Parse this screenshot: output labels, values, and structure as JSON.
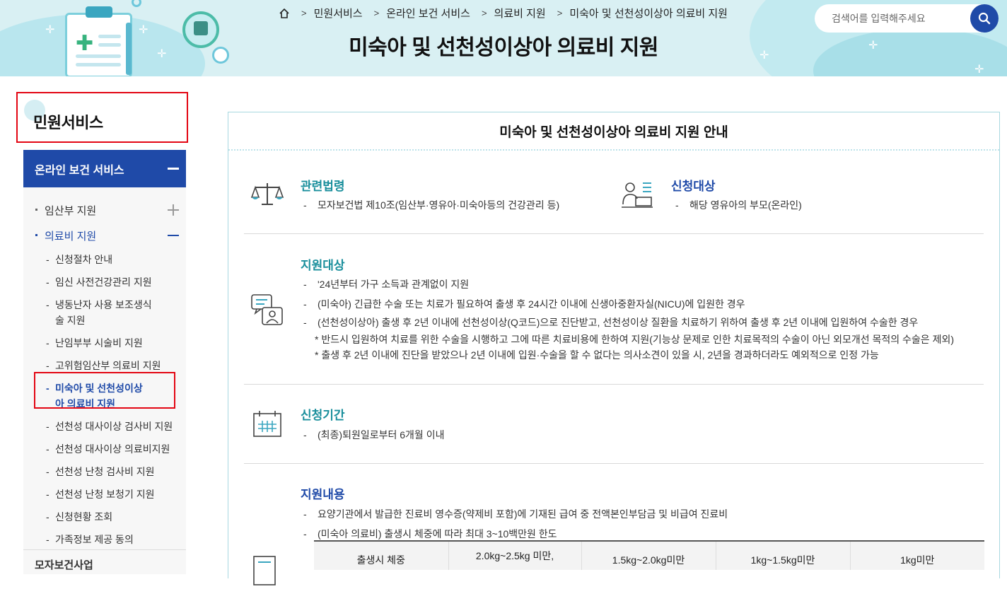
{
  "header": {
    "breadcrumb": [
      "민원서비스",
      "온라인 보건 서비스",
      "의료비 지원",
      "미숙아 및 선천성이상아 의료비 지원"
    ],
    "page_title": "미숙아 및 선천성이상아 의료비 지원",
    "search_placeholder": "검색어를 입력해주세요"
  },
  "sidebar": {
    "title": "민원서비스",
    "section_label": "온라인 보건 서비스",
    "depth2": [
      {
        "label": "임산부 지원",
        "state": "collapsed"
      },
      {
        "label": "의료비 지원",
        "state": "expanded"
      }
    ],
    "depth3": [
      "신청절차 안내",
      "임신 사전건강관리 지원",
      "냉동난자 사용 보조생식술 지원",
      "난임부부 시술비 지원",
      "고위험임산부 의료비 지원",
      "미숙아 및 선천성이상아 의료비 지원",
      "선천성 대사이상 검사비 지원",
      "선천성 대사이상 의료비지원",
      "선천성 난청 검사비 지원",
      "선천성 난청 보청기 지원",
      "신청현황 조회",
      "가족정보 제공 동의"
    ],
    "next_section_label": "모자보건사업"
  },
  "content": {
    "title": "미숙아 및 선천성이상아 의료비 지원 안내",
    "law": {
      "heading": "관련법령",
      "items": [
        "모자보건법 제10조(임산부·영유아·미숙아등의 건강관리 등)"
      ]
    },
    "applicant": {
      "heading": "신청대상",
      "items": [
        "해당 영유아의 부모(온라인)"
      ]
    },
    "target": {
      "heading": "지원대상",
      "items": [
        "'24년부터 가구 소득과 관계없이 지원",
        "(미숙아) 긴급한 수술 또는 치료가 필요하여 출생 후 24시간 이내에 신생아중환자실(NICU)에 입원한 경우",
        "(선천성이상아) 출생 후 2년 이내에 선천성이상(Q코드)으로 진단받고, 선천성이상 질환을 치료하기 위하여 출생 후 2년 이내에 입원하여 수술한 경우"
      ],
      "notes": [
        "* 반드시 입원하여 치료를 위한 수술을 시행하고 그에 따른 치료비용에 한하여 지원(기능상 문제로 인한 치료목적의 수술이 아닌 외모개선 목적의 수술은 제외)",
        "* 출생 후 2년 이내에 진단을 받았으나 2년 이내에 입원·수술을 할 수 없다는 의사소견이 있을 시, 2년을 경과하더라도 예외적으로 인정 가능"
      ]
    },
    "period": {
      "heading": "신청기간",
      "items": [
        "(최종)퇴원일로부터 6개월 이내"
      ]
    },
    "support": {
      "heading": "지원내용",
      "items": [
        "요양기관에서 발급한 진료비 영수증(약제비 포함)에 기재된 급여 중 전액본인부담금 및 비급여 진료비",
        "(미숙아 의료비) 출생시 체중에 따라 최대 3~10백만원 한도"
      ],
      "table_header": [
        "출생시 체중",
        "2.0kg~2.5kg 미만,",
        "1.5kg~2.0kg미만",
        "1kg~1.5kg미만",
        "1kg미만"
      ]
    }
  },
  "colors": {
    "brand_blue": "#1f4aa8",
    "heading_teal": "#1a8f9c",
    "highlight_red": "#e30613"
  }
}
